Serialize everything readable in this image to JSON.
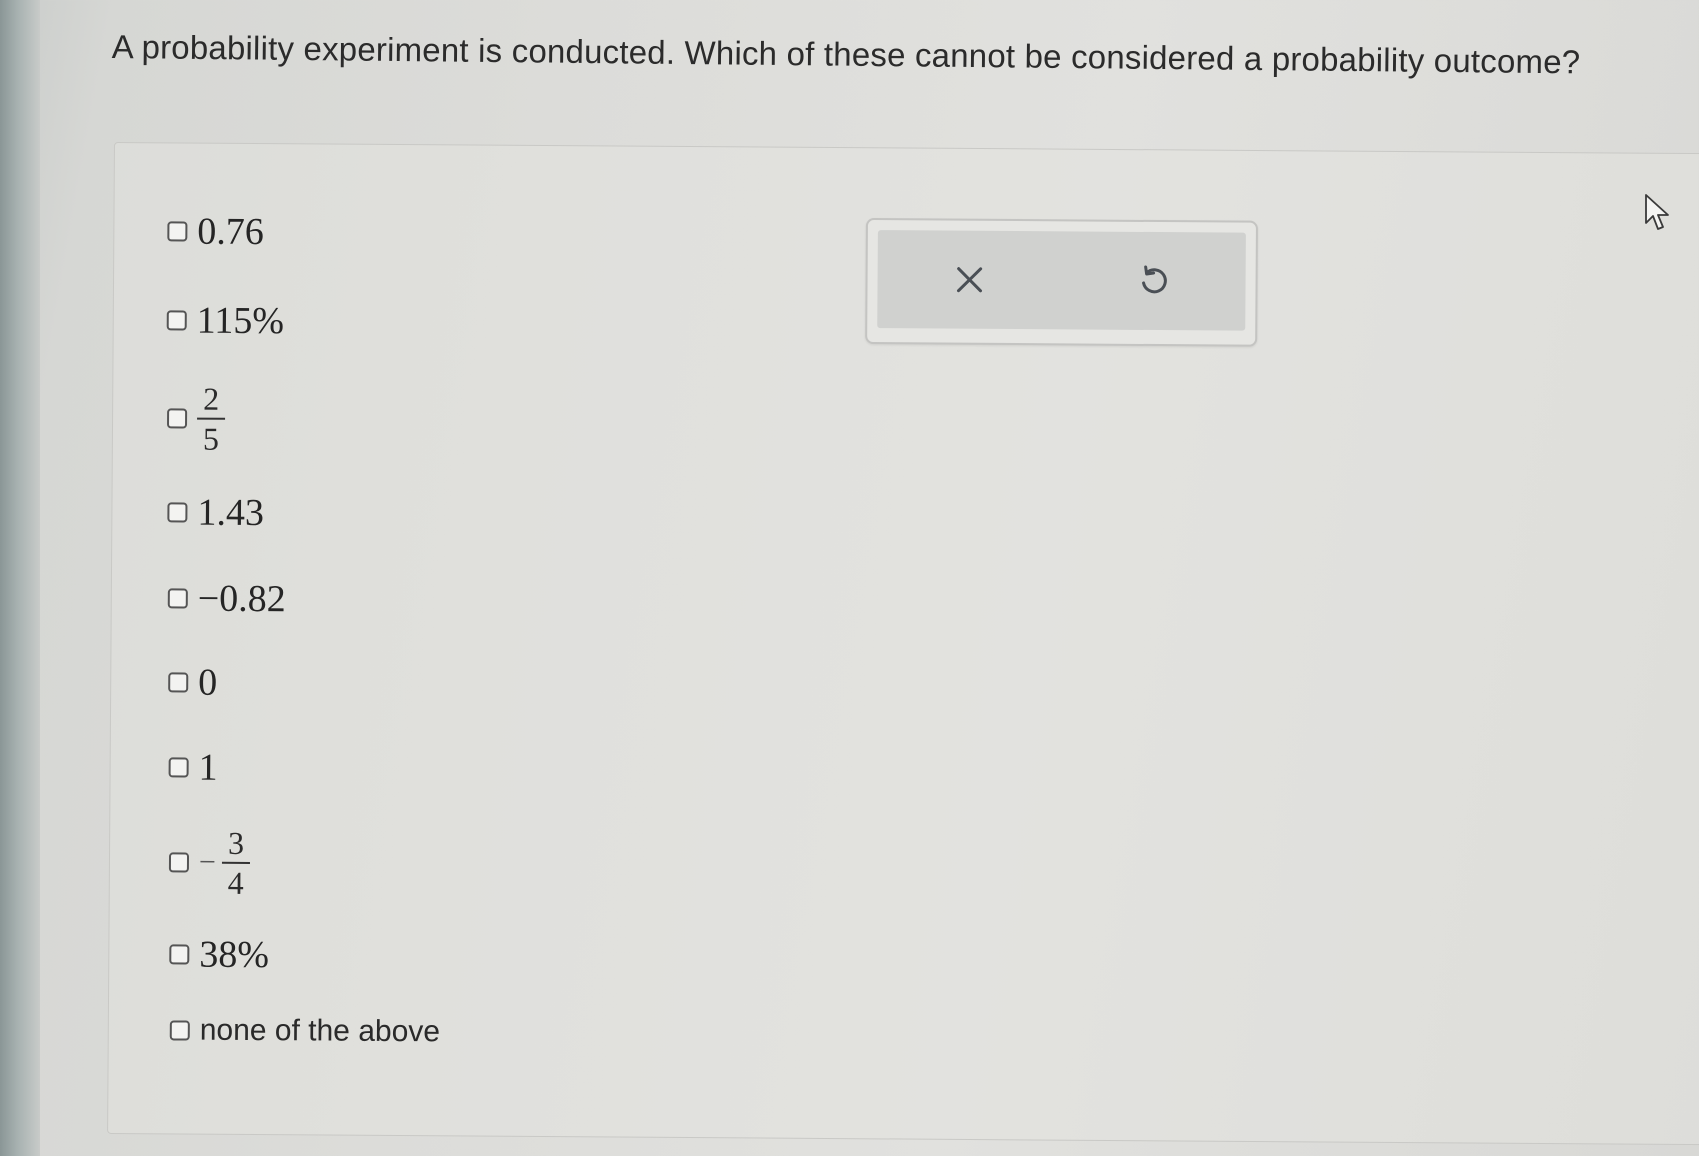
{
  "question": {
    "text": "A probability experiment is conducted. Which of these cannot be considered a probability outcome?"
  },
  "options": [
    {
      "id": "opt-1",
      "label": "0.76",
      "type": "text"
    },
    {
      "id": "opt-2",
      "label": "115%",
      "type": "text"
    },
    {
      "id": "opt-3",
      "type": "fraction",
      "numerator": "2",
      "denominator": "5",
      "sign": ""
    },
    {
      "id": "opt-4",
      "label": "1.43",
      "type": "text"
    },
    {
      "id": "opt-5",
      "label": "−0.82",
      "type": "text"
    },
    {
      "id": "opt-6",
      "label": "0",
      "type": "text"
    },
    {
      "id": "opt-7",
      "label": "1",
      "type": "text"
    },
    {
      "id": "opt-8",
      "type": "fraction",
      "numerator": "3",
      "denominator": "4",
      "sign": "−"
    },
    {
      "id": "opt-9",
      "label": "38%",
      "type": "text"
    },
    {
      "id": "opt-10",
      "label": "none of the above",
      "type": "text"
    }
  ],
  "toolbar": {
    "clear_icon": "close-icon",
    "undo_icon": "undo-icon"
  },
  "colors": {
    "checkbox_border": "#555555",
    "panel_border": "#c9c9c6",
    "toolbar_fill": "#d0d1cf"
  }
}
